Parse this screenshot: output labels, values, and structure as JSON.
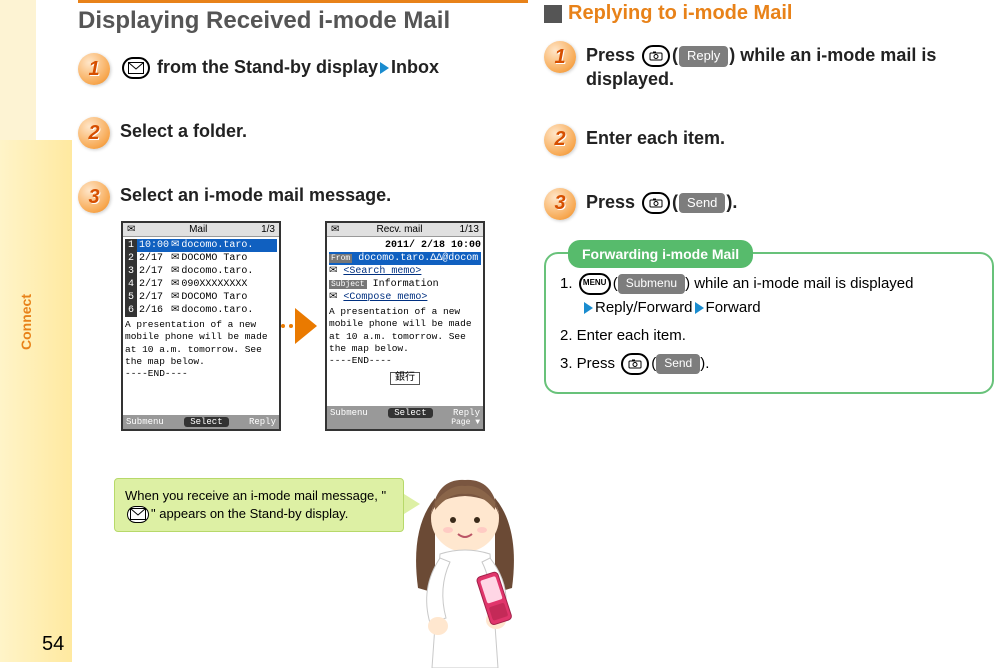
{
  "page_number": "54",
  "sidebar_label": "Connect",
  "left": {
    "title": "Displaying Received i-mode Mail",
    "step1": {
      "pre_icon_a": "",
      "text_a": " from the Stand-by display",
      "text_b": "Inbox"
    },
    "step2": "Select a folder.",
    "step3": "Select an i-mode mail message.",
    "screen1": {
      "header_left": "Mail",
      "header_right": "1/3",
      "rows": [
        {
          "idx": "1",
          "date": "10:00",
          "from": "docomo.taro."
        },
        {
          "idx": "2",
          "date": "2/17",
          "from": "DOCOMO Taro"
        },
        {
          "idx": "3",
          "date": "2/17",
          "from": "docomo.taro."
        },
        {
          "idx": "4",
          "date": "2/17",
          "from": "090XXXXXXXX"
        },
        {
          "idx": "5",
          "date": "2/17",
          "from": "DOCOMO Taro"
        },
        {
          "idx": "6",
          "date": "2/16",
          "from": "docomo.taro."
        }
      ],
      "body": "A presentation of a new mobile phone will be made at 10 a.m. tomorrow. See the map below.\n----END----",
      "foot_l": "Submenu",
      "foot_c": "Select",
      "foot_r": "Reply"
    },
    "screen2": {
      "header_left": "Recv. mail",
      "header_right": "1/13",
      "date": "2011/ 2/18 10:00",
      "from_label": "From",
      "from": "docomo.taro.ΔΔ@docom",
      "search": "<Search memo>",
      "subject_label": "Subject",
      "subject": "Information",
      "compose": "<Compose memo>",
      "body": "A presentation of a new mobile phone will be made at 10 a.m. tomorrow. See the map below.\n----END----",
      "bank": "銀行",
      "foot_l": "Submenu",
      "foot_c": "Select",
      "foot_r": "Reply",
      "page": "Page ▼"
    },
    "tip_a": "When you receive an i-mode mail message, \"",
    "tip_b": "\" appears on the Stand-by display."
  },
  "right": {
    "heading": "Replying to i-mode Mail",
    "step1_a": "Press ",
    "step1_btn": "Reply",
    "step1_b": ") while an i-mode mail is displayed.",
    "step2": "Enter each item.",
    "step3_a": "Press ",
    "step3_btn": "Send",
    "step3_b": ").",
    "forward": {
      "label": "Forwarding i-mode Mail",
      "s1a": "1. ",
      "s1_btn": "Submenu",
      "s1b": ") while an i-mode mail is displayed",
      "s1c_a": "Reply/Forward",
      "s1c_b": "Forward",
      "s2": "2. Enter each item.",
      "s3a": "3. Press ",
      "s3_btn": "Send",
      "s3b": ")."
    }
  }
}
